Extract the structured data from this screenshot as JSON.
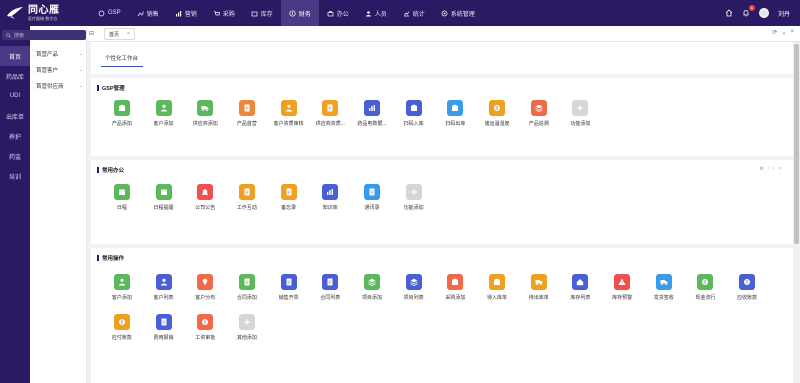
{
  "app": {
    "title": "同心雁",
    "subtitle": "医疗器械·数字仓"
  },
  "nav": [
    {
      "label": "GSP",
      "icon": "gsp-icon"
    },
    {
      "label": "销售",
      "icon": "sales-icon"
    },
    {
      "label": "营销",
      "icon": "marketing-icon"
    },
    {
      "label": "采购",
      "icon": "purchase-icon"
    },
    {
      "label": "库存",
      "icon": "stock-icon"
    },
    {
      "label": "财务",
      "icon": "finance-icon",
      "active": true
    },
    {
      "label": "办公",
      "icon": "office-icon"
    },
    {
      "label": "人员",
      "icon": "people-icon"
    },
    {
      "label": "统计",
      "icon": "stats-icon"
    },
    {
      "label": "系统管理",
      "icon": "settings-icon"
    }
  ],
  "header": {
    "notification_count": "1",
    "user_name": "刘丹"
  },
  "sidebar": {
    "search_placeholder": "搜索",
    "items": [
      {
        "label": "首页",
        "active": true
      },
      {
        "label": "药品库"
      },
      {
        "label": "UDI"
      },
      {
        "label": "出库单"
      },
      {
        "label": "养护"
      },
      {
        "label": "药监"
      },
      {
        "label": "培训"
      }
    ]
  },
  "submenu": {
    "items": [
      {
        "label": "首营产品"
      },
      {
        "label": "首营客户"
      },
      {
        "label": "首营供应商"
      }
    ]
  },
  "tabs": {
    "current": "首页"
  },
  "workspace_tab": "个性化工作台",
  "panels": [
    {
      "title": "GSP管理",
      "tiles": [
        {
          "label": "产品添加",
          "color": "#5cb85c",
          "icon": "product-add-icon"
        },
        {
          "label": "客户添加",
          "color": "#5cb85c",
          "icon": "customer-add-icon"
        },
        {
          "label": "供应商添加",
          "color": "#5cb85c",
          "icon": "supplier-add-icon"
        },
        {
          "label": "产品首营",
          "color": "#f0883a",
          "icon": "product-first-icon"
        },
        {
          "label": "客户资质审核",
          "color": "#f0a020",
          "icon": "customer-review-icon"
        },
        {
          "label": "供应商资质...",
          "color": "#f0a020",
          "icon": "supplier-review-icon"
        },
        {
          "label": "药品电数据...",
          "color": "#4a5fd6",
          "icon": "drug-data-icon"
        },
        {
          "label": "扫码入库",
          "color": "#4a5fd6",
          "icon": "scan-in-icon"
        },
        {
          "label": "扫码出库",
          "color": "#3a9be8",
          "icon": "scan-out-icon"
        },
        {
          "label": "储运温湿度",
          "color": "#f0a020",
          "icon": "temp-humidity-icon"
        },
        {
          "label": "产品追溯",
          "color": "#f06a4a",
          "icon": "trace-icon"
        },
        {
          "label": "功能添加",
          "color": "#d6d6d6",
          "icon": "plus-icon"
        }
      ]
    },
    {
      "title": "常用办公",
      "tiles": [
        {
          "label": "日程",
          "color": "#5cb85c",
          "icon": "schedule-icon"
        },
        {
          "label": "日程提醒",
          "color": "#5cb85c",
          "icon": "reminder-icon"
        },
        {
          "label": "公司公告",
          "color": "#f05050",
          "icon": "announcement-icon"
        },
        {
          "label": "工作互动",
          "color": "#f0a020",
          "icon": "interaction-icon"
        },
        {
          "label": "备忘录",
          "color": "#f0a020",
          "icon": "memo-icon"
        },
        {
          "label": "知识库",
          "color": "#4a5fd6",
          "icon": "knowledge-icon"
        },
        {
          "label": "通讯录",
          "color": "#3a9be8",
          "icon": "contacts-icon"
        },
        {
          "label": "功能添加",
          "color": "#d6d6d6",
          "icon": "plus-icon"
        }
      ]
    },
    {
      "title": "常用操作",
      "tiles": [
        {
          "label": "客户添加",
          "color": "#5cb85c",
          "icon": "customer-add-icon"
        },
        {
          "label": "客户列表",
          "color": "#4a5fd6",
          "icon": "customer-list-icon"
        },
        {
          "label": "客户分布",
          "color": "#f06a4a",
          "icon": "distribution-icon"
        },
        {
          "label": "合同添加",
          "color": "#5cb85c",
          "icon": "contract-add-icon"
        },
        {
          "label": "销售开票",
          "color": "#4a5fd6",
          "icon": "invoice-icon"
        },
        {
          "label": "合同列表",
          "color": "#4a5fd6",
          "icon": "contract-list-icon"
        },
        {
          "label": "项目添加",
          "color": "#5cb85c",
          "icon": "project-add-icon"
        },
        {
          "label": "项目列表",
          "color": "#4a5fd6",
          "icon": "project-list-icon"
        },
        {
          "label": "采购添加",
          "color": "#f06a4a",
          "icon": "purchase-add-icon"
        },
        {
          "label": "待入库单",
          "color": "#f0a020",
          "icon": "pending-in-icon"
        },
        {
          "label": "待出库单",
          "color": "#f0a020",
          "icon": "pending-out-icon"
        },
        {
          "label": "库存列表",
          "color": "#4a5fd6",
          "icon": "stock-list-icon"
        },
        {
          "label": "库存预警",
          "color": "#f05050",
          "icon": "stock-alert-icon"
        },
        {
          "label": "发货签收",
          "color": "#3a9be8",
          "icon": "delivery-icon"
        },
        {
          "label": "现金流行",
          "color": "#5cb85c",
          "icon": "cashflow-icon"
        },
        {
          "label": "应收账款",
          "color": "#4a5fd6",
          "icon": "receivable-icon"
        },
        {
          "label": "应付账款",
          "color": "#f0a020",
          "icon": "payable-icon"
        },
        {
          "label": "费用报销",
          "color": "#4a5fd6",
          "icon": "expense-icon"
        },
        {
          "label": "工资审批",
          "color": "#f06a4a",
          "icon": "salary-icon"
        },
        {
          "label": "其他添加",
          "color": "#d6d6d6",
          "icon": "plus-icon"
        }
      ]
    }
  ]
}
